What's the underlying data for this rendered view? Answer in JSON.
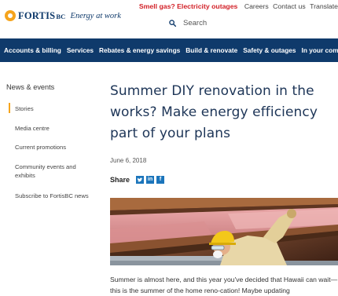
{
  "brand": {
    "name": "FORTIS",
    "suffix": "BC",
    "tagline": "Energy at work"
  },
  "utility": {
    "alert": "Smell gas? Electricity outages",
    "links": [
      "Careers",
      "Contact us",
      "Translate"
    ]
  },
  "search": {
    "placeholder": "Search"
  },
  "nav": {
    "items": [
      "Accounts & billing",
      "Services",
      "Rebates & energy savings",
      "Build & renovate",
      "Safety & outages",
      "In your community"
    ]
  },
  "sidebar": {
    "heading": "News & events",
    "items": [
      {
        "label": "Stories",
        "active": true
      },
      {
        "label": "Media centre"
      },
      {
        "label": "Current promotions"
      },
      {
        "label": "Community events and exhibits"
      },
      {
        "label": "Subscribe to FortisBC news"
      }
    ]
  },
  "article": {
    "title": "Summer DIY renovation in the works? Make energy efficiency part of your plans",
    "date": "June 6, 2018",
    "share_label": "Share",
    "share_icons": [
      "twitter-icon",
      "linkedin-icon",
      "facebook-icon"
    ],
    "body": "Summer is almost here, and this year you've decided that Hawaii can wait—this is the summer of the home reno-cation! Maybe updating"
  },
  "colors": {
    "navy": "#0f3a6b",
    "alert_red": "#d21f26",
    "accent_orange": "#f5a41d",
    "share_blue": "#1b75bb"
  }
}
